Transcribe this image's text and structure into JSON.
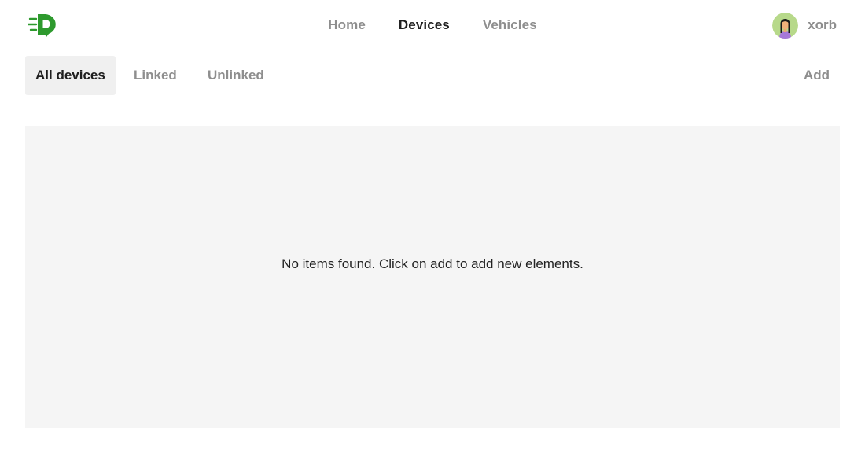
{
  "header": {
    "logo_icon": "logo-d-icon",
    "nav": [
      {
        "label": "Home",
        "active": false
      },
      {
        "label": "Devices",
        "active": true
      },
      {
        "label": "Vehicles",
        "active": false
      }
    ],
    "user": {
      "name": "xorb",
      "avatar_icon": "avatar-icon"
    }
  },
  "tabs": [
    {
      "label": "All devices",
      "active": true
    },
    {
      "label": "Linked",
      "active": false
    },
    {
      "label": "Unlinked",
      "active": false
    }
  ],
  "actions": {
    "add_label": "Add"
  },
  "content": {
    "empty_message": "No items found. Click on add to add new elements."
  },
  "colors": {
    "brand": "#2e9a2e",
    "active_text": "#1f1f1f",
    "inactive_text": "#8e8e8e",
    "panel_bg": "#f5f5f5",
    "active_tab_bg": "#f0f0f0"
  }
}
